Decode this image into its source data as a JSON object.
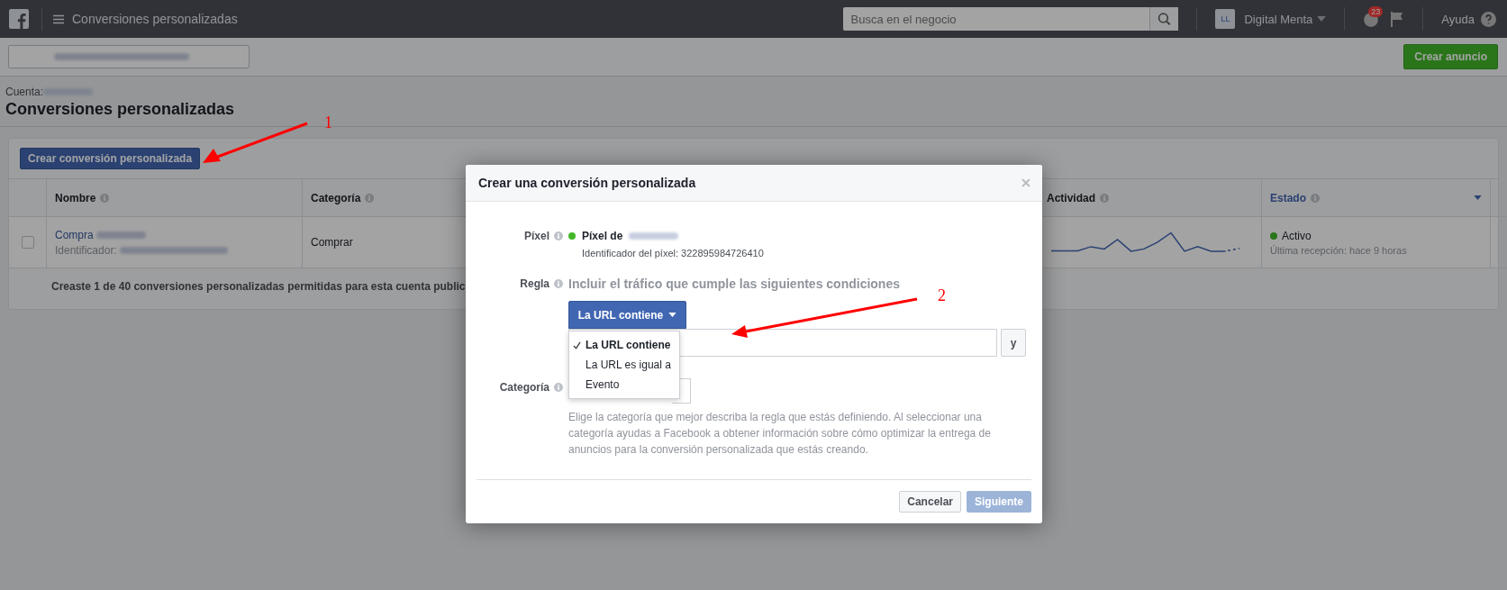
{
  "topbar": {
    "title": "Conversiones personalizadas",
    "search": {
      "placeholder": "Busca en el negocio"
    },
    "account": {
      "initials": "LL",
      "name": "Digital Menta"
    },
    "notifications": "23",
    "help": "Ayuda"
  },
  "subbar": {
    "create_ad": "Crear anuncio"
  },
  "header": {
    "account_label": "Cuenta:",
    "title": "Conversiones personalizadas"
  },
  "table": {
    "create_button": "Crear conversión personalizada",
    "columns": [
      {
        "label": "Nombre",
        "sorted": false
      },
      {
        "label": "Categoría",
        "sorted": false
      },
      {
        "label": "Actividad",
        "sorted": false
      },
      {
        "label": "Estado",
        "sorted": true
      }
    ],
    "rows": [
      {
        "checked": false,
        "name": "Compra",
        "id_label": "Identificador:",
        "category": "Comprar",
        "status": "Activo",
        "last_received": "Última recepción: hace 9 horas"
      }
    ],
    "footer": "Creaste 1 de 40 conversiones personalizadas permitidas para esta cuenta public"
  },
  "modal": {
    "title": "Crear una conversión personalizada",
    "pixel_label": "Píxel",
    "pixel_name": "Píxel de",
    "pixel_id": "Identificador del píxel: 322895984726410",
    "rule_label": "Regla",
    "rule_text": "Incluir el tráfico que cumple las siguientes condiciones",
    "rule_dropdown": "La URL contiene",
    "rule_options": [
      {
        "label": "La URL contiene",
        "selected": true
      },
      {
        "label": "La URL es igual a",
        "selected": false
      },
      {
        "label": "Evento",
        "selected": false
      }
    ],
    "and_button": "y",
    "category_label": "Categoría",
    "category_help": "Elige la categoría que mejor describa la regla que estás definiendo. Al seleccionar una categoría ayudas a Facebook a obtener información sobre cómo optimizar la entrega de anuncios para la conversión personalizada que estás creando.",
    "cancel": "Cancelar",
    "next": {
      "label": "Siguiente",
      "disabled": true
    }
  },
  "annotations": [
    {
      "label": "1"
    },
    {
      "label": "2"
    }
  ]
}
